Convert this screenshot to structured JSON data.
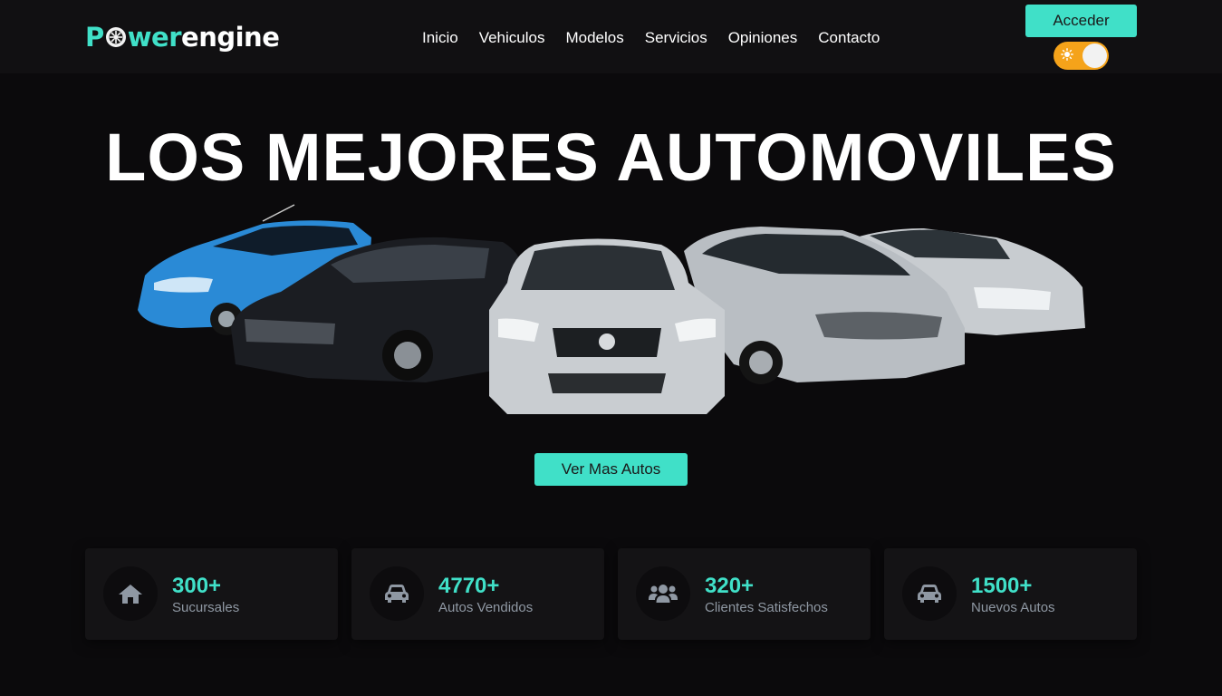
{
  "brand": {
    "logo_part1": "P",
    "logo_part2": "wer",
    "logo_part3": "engine",
    "accent_color": "#40e0c8"
  },
  "nav": {
    "links": [
      "Inicio",
      "Vehiculos",
      "Modelos",
      "Servicios",
      "Opiniones",
      "Contacto"
    ],
    "login_label": "Acceder",
    "theme_toggle": {
      "icon": "sun-icon",
      "state": "light-off"
    }
  },
  "hero": {
    "title": "LOS MEJORES AUTOMOVILES",
    "image_alt": "cars-lineup-image",
    "cta_label": "Ver Mas Autos"
  },
  "stats": [
    {
      "icon": "house-icon",
      "number": "300+",
      "label": "Sucursales"
    },
    {
      "icon": "car-icon",
      "number": "4770+",
      "label": "Autos Vendidos"
    },
    {
      "icon": "users-icon",
      "number": "320+",
      "label": "Clientes Satisfechos"
    },
    {
      "icon": "car-icon",
      "number": "1500+",
      "label": "Nuevos Autos"
    }
  ]
}
